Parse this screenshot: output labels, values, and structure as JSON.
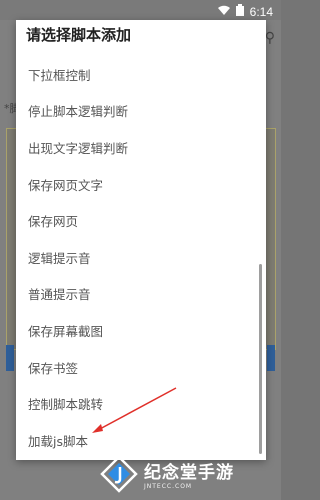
{
  "status": {
    "time": "6:14"
  },
  "background": {
    "required_label": "*脚",
    "search_icon": "search-icon"
  },
  "dialog": {
    "title": "请选择脚本添加",
    "items": [
      {
        "label": "下拉框控制"
      },
      {
        "label": "停止脚本逻辑判断"
      },
      {
        "label": "出现文字逻辑判断"
      },
      {
        "label": "保存网页文字"
      },
      {
        "label": "保存网页"
      },
      {
        "label": "逻辑提示音"
      },
      {
        "label": "普通提示音"
      },
      {
        "label": "保存屏幕截图"
      },
      {
        "label": "保存书签"
      },
      {
        "label": "控制脚本跳转"
      },
      {
        "label": "加载js脚本"
      }
    ]
  },
  "watermark": {
    "main": "纪念堂手游",
    "sub": "JNTECC.COM"
  },
  "colors": {
    "arrow": "#e0302a",
    "dialog_bg": "#ffffff",
    "overlay": "#757575"
  }
}
